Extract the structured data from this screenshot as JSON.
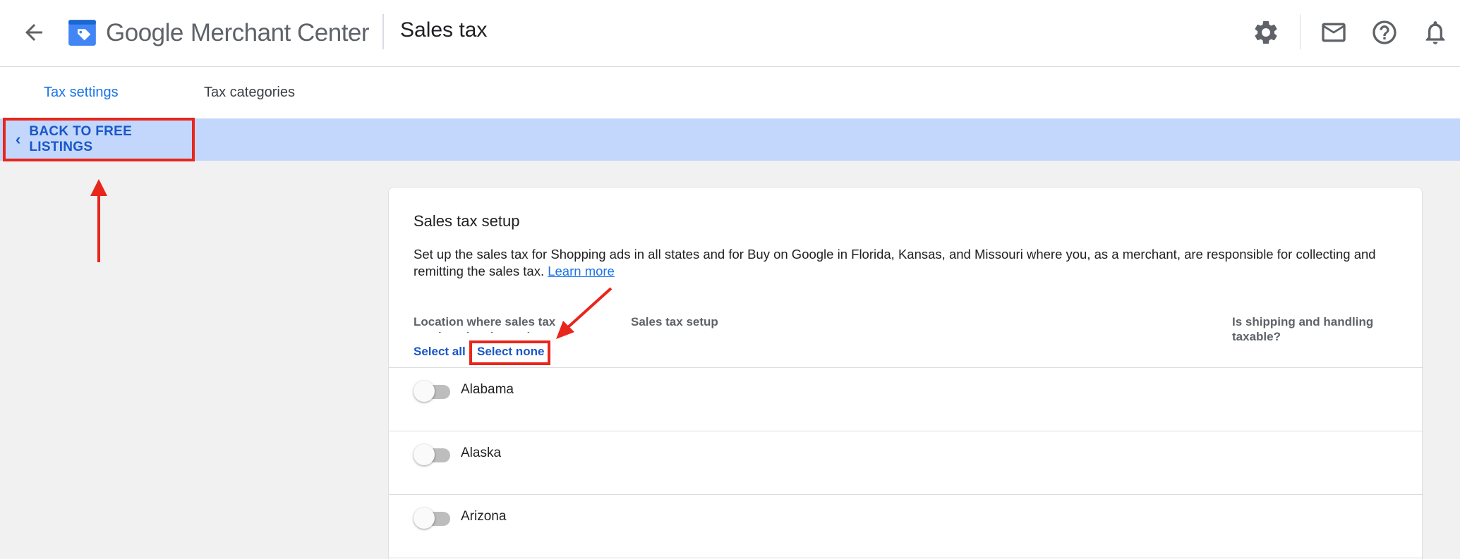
{
  "header": {
    "brand_google": "Google",
    "brand_product": "Merchant Center",
    "page_title": "Sales tax",
    "icons": [
      "back-arrow-icon",
      "merchant-center-logo-icon",
      "settings-gear-icon",
      "mail-icon",
      "help-icon",
      "notifications-bell-icon"
    ]
  },
  "tabs": [
    {
      "label": "Tax settings",
      "active": true
    },
    {
      "label": "Tax categories",
      "active": false
    }
  ],
  "back_bar": {
    "label": "BACK TO FREE LISTINGS"
  },
  "card": {
    "title": "Sales tax setup",
    "description": "Set up the sales tax for Shopping ads in all states and for Buy on Google in Florida, Kansas, and Missouri where you, as a merchant, are responsible for collecting and remitting the sales tax.",
    "learn_more": "Learn more",
    "columns": {
      "location": "Location where sales tax needs to be charged",
      "setup": "Sales tax setup",
      "shipping": "Is shipping and handling taxable?"
    },
    "select_all": "Select all",
    "select_none": "Select none",
    "rows": [
      {
        "state": "Alabama",
        "enabled": false
      },
      {
        "state": "Alaska",
        "enabled": false
      },
      {
        "state": "Arizona",
        "enabled": false
      }
    ]
  },
  "colors": {
    "accent": "#1a73e8",
    "back_bar_bg": "#c2d7fb",
    "annotation": "#e8261b"
  }
}
